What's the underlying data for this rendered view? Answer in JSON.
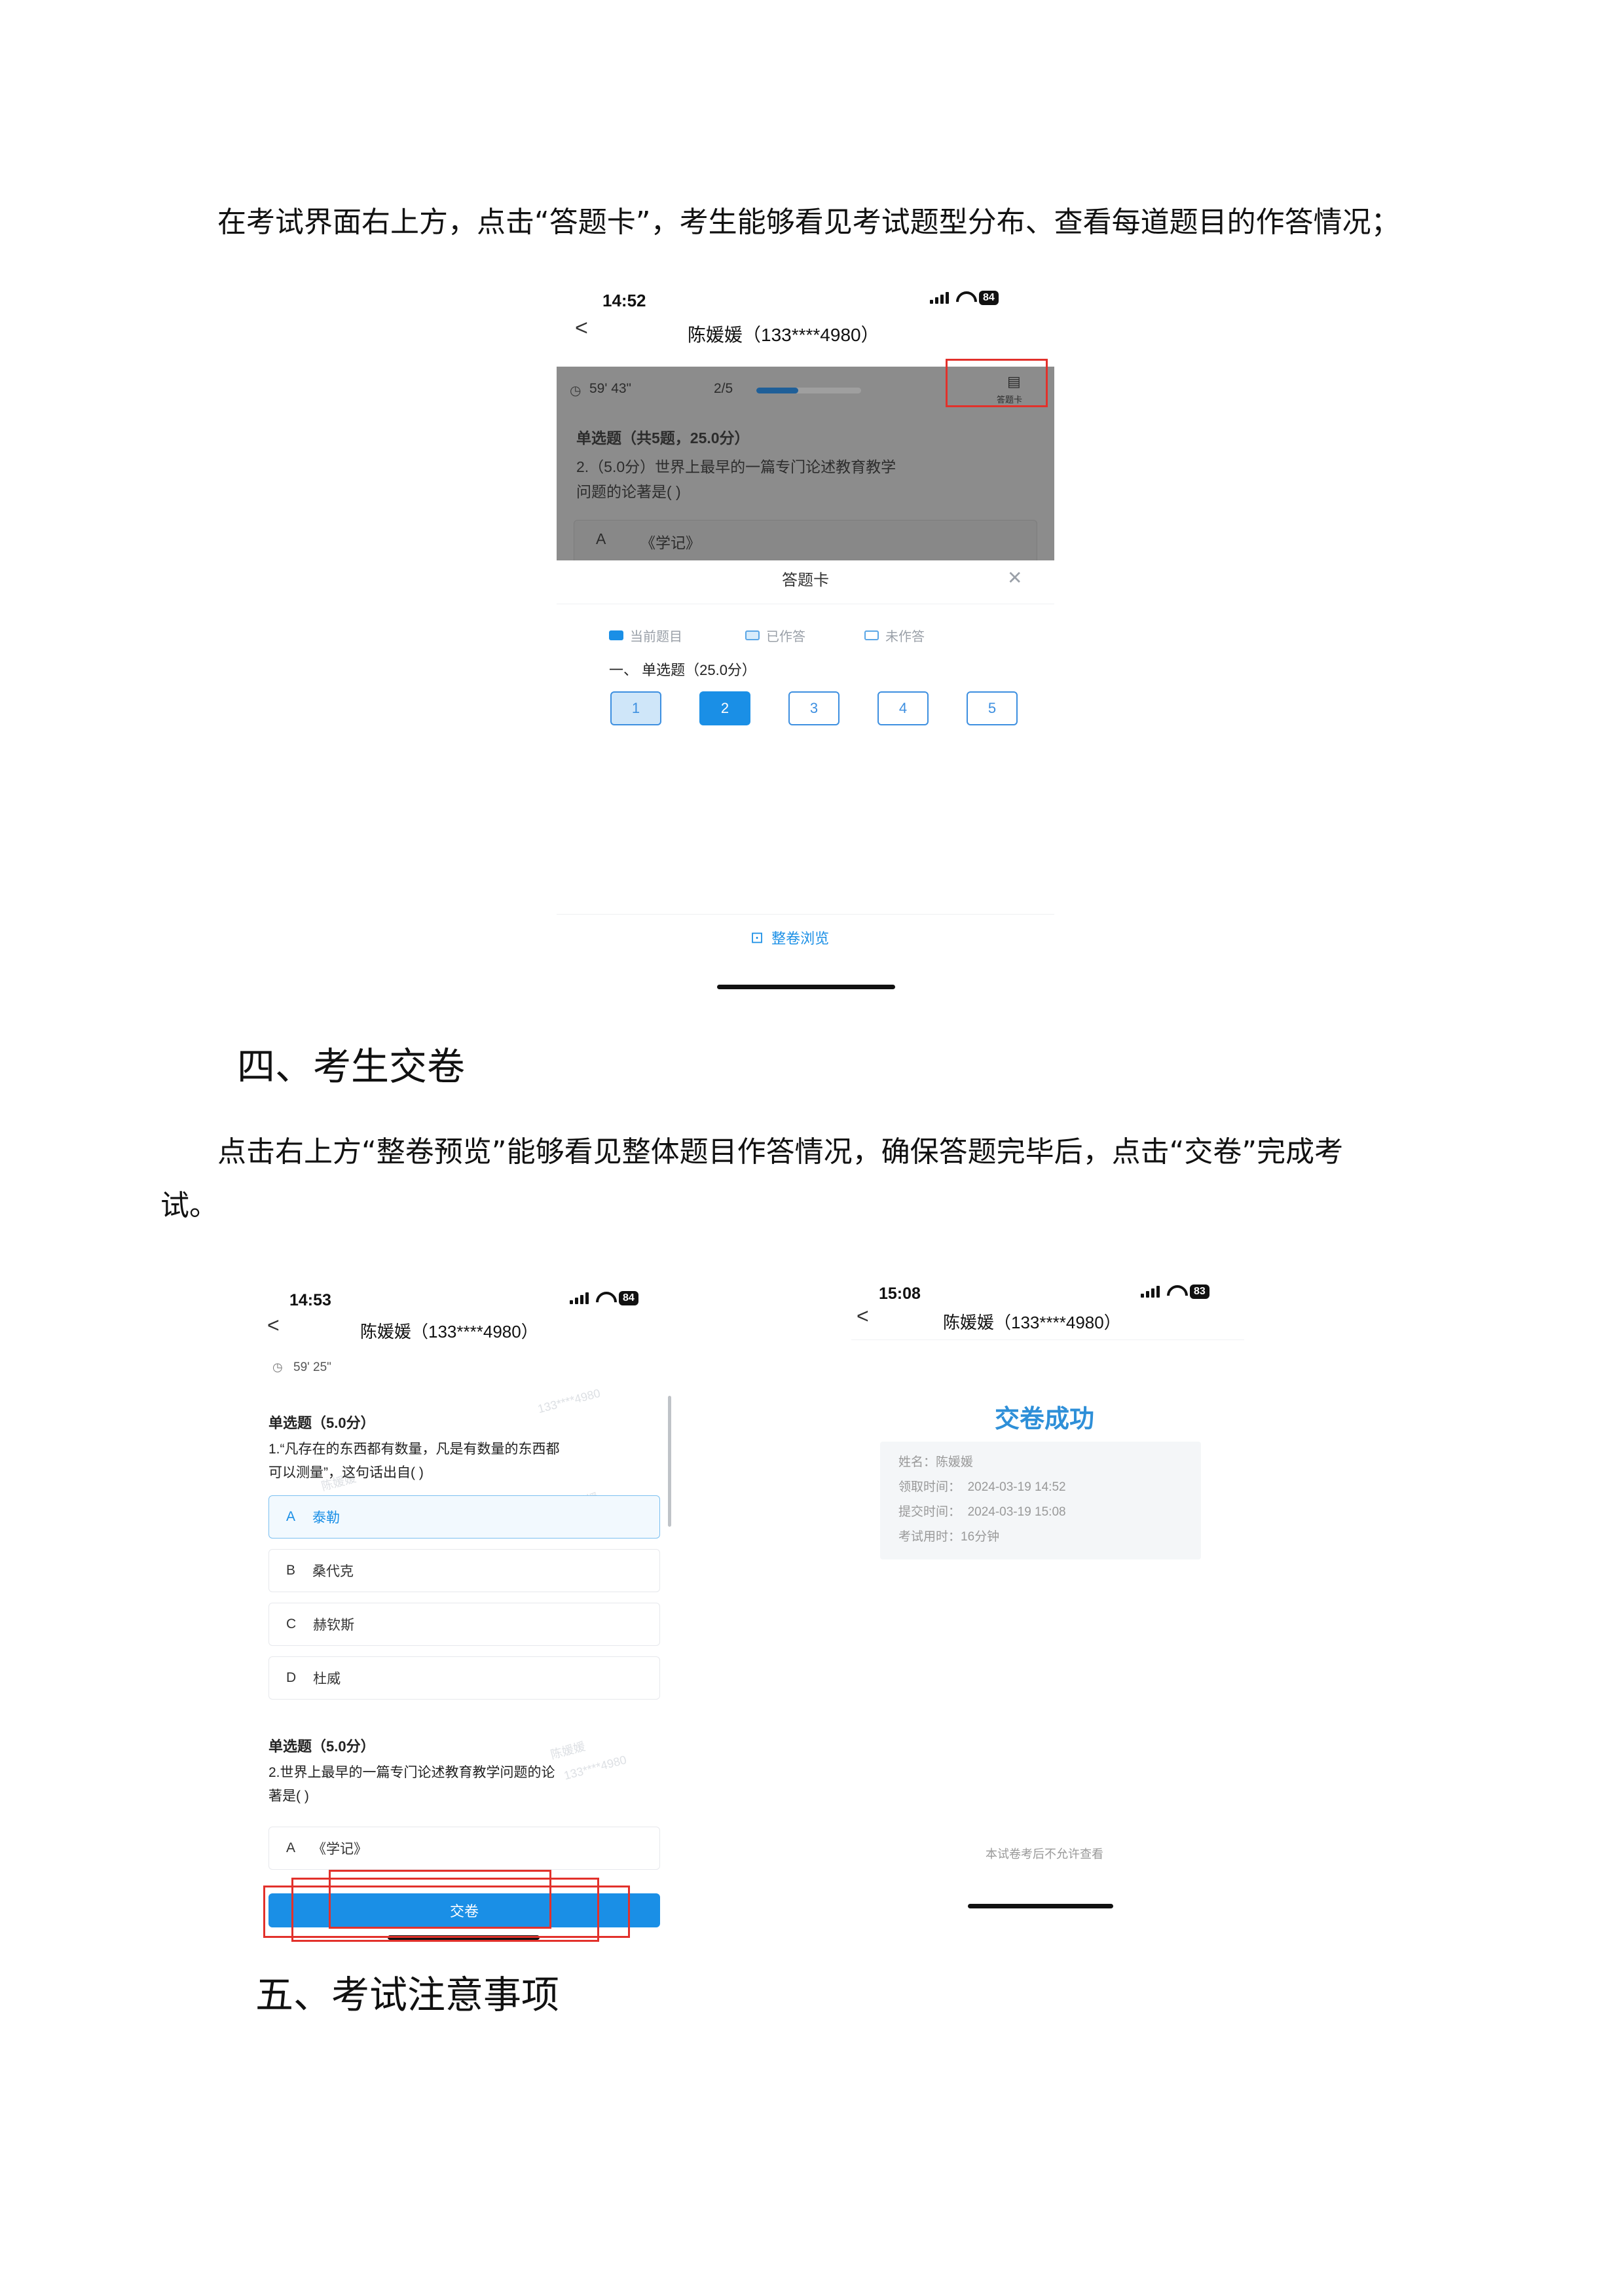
{
  "doc": {
    "para1": "在考试界面右上方，点击“答题卡”，考生能够看见考试题型分布、查看每道题目的作答情况；",
    "heading4": "四、考生交卷",
    "para2_line1": "点击右上方“整卷预览”能够看见整体题目作答情况，确保答题完毕后，点击“交卷”完成考",
    "para2_line2": "试。",
    "heading5": "五、考试注意事项"
  },
  "phone1": {
    "time": "14:52",
    "battery": "84",
    "back": "<",
    "title": "陈媛媛（133****4980）",
    "timer": "59' 43\"",
    "progress_text": "2/5",
    "progress_fraction": 0.4,
    "card_button": "答题卡",
    "section_header": "单选题（共5题，25.0分）",
    "question_line1": "2.（5.0分）世界上最早的一篇专门论述教育教学",
    "question_line2": "问题的论著是(    )",
    "option_a_letter": "A",
    "option_a_text": "《学记》",
    "sheet_title": "答题卡",
    "close": "✕",
    "legend": [
      "当前题目",
      "已作答",
      "未作答"
    ],
    "group_title": "一、 单选题（25.0分）",
    "numbers": [
      "1",
      "2",
      "3",
      "4",
      "5"
    ],
    "preview": "整卷浏览"
  },
  "phone2": {
    "time": "14:53",
    "battery": "84",
    "back": "<",
    "title": "陈媛媛（133****4980）",
    "timer": "59' 25\"",
    "q1_head": "单选题（5.0分）",
    "q1_line1": "1.“凡存在的东西都有数量，凡是有数量的东西都",
    "q1_line2": "可以测量”，这句话出自(    )",
    "options": [
      {
        "letter": "A",
        "text": "泰勒"
      },
      {
        "letter": "B",
        "text": "桑代克"
      },
      {
        "letter": "C",
        "text": "赫钦斯"
      },
      {
        "letter": "D",
        "text": "杜威"
      }
    ],
    "q2_head": "单选题（5.0分）",
    "q2_line1": "2.世界上最早的一篇专门论述教育教学问题的论",
    "q2_line2": "著是(    )",
    "q2_option_letter": "A",
    "q2_option_text": "《学记》",
    "submit": "交卷"
  },
  "phone3": {
    "time": "15:08",
    "battery": "83",
    "back": "<",
    "title": "陈媛媛（133****4980）",
    "success": "交卷成功",
    "info": [
      {
        "label": "姓名：",
        "value": "陈媛媛"
      },
      {
        "label": "领取时间：",
        "value": "2024-03-19 14:52"
      },
      {
        "label": "提交时间：",
        "value": "2024-03-19 15:08"
      },
      {
        "label": "考试用时：",
        "value": "16分钟"
      }
    ],
    "note": "本试卷考后不允许查看"
  },
  "colors": {
    "accent": "#1a8fe6",
    "highlight_red": "#e2312b",
    "success_blue": "#2e8fd8"
  }
}
